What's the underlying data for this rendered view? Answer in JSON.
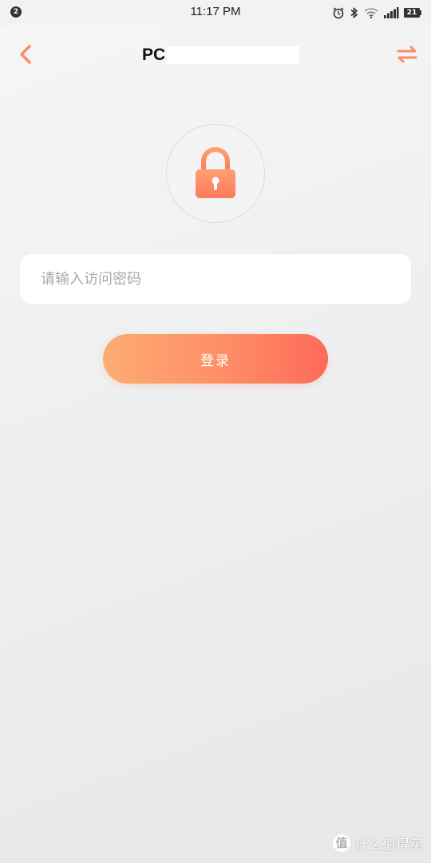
{
  "status_bar": {
    "notification_count": "2",
    "time": "11:17 PM",
    "battery": "21",
    "icons": [
      "alarm-icon",
      "bluetooth-icon",
      "wifi-icon",
      "signal-icon",
      "battery-icon"
    ]
  },
  "nav": {
    "title": "PC",
    "back_icon": "chevron-left-icon",
    "switch_icon": "swap-arrows-icon"
  },
  "lock": {
    "icon": "lock-icon"
  },
  "form": {
    "password_placeholder": "请输入访问密码",
    "password_value": "",
    "login_label": "登录"
  },
  "watermark": {
    "logo": "值",
    "text": "什么值得买"
  },
  "colors": {
    "accent": "#fe8a66",
    "gradient_start": "#fdac72",
    "gradient_end": "#fd6a5a",
    "background": "#eeeff0"
  }
}
